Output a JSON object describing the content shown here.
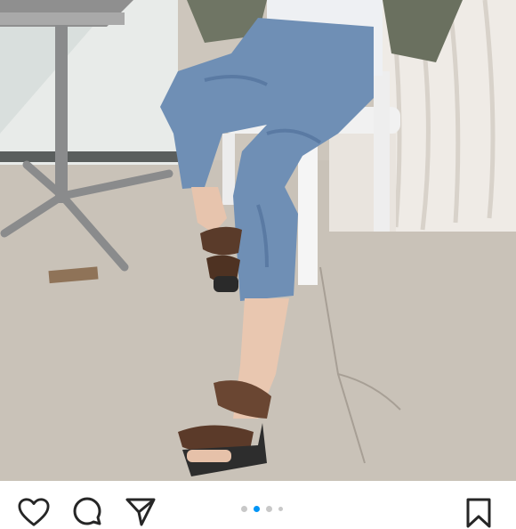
{
  "post": {
    "image_description_icon": "photo",
    "carousel": {
      "count": 5,
      "active_index": 1
    }
  },
  "actions": {
    "like_icon": "heart-icon",
    "comment_icon": "comment-icon",
    "share_icon": "send-icon",
    "save_icon": "bookmark-icon"
  },
  "colors": {
    "active_dot": "#0095f6",
    "inactive_dot": "#c8c8c8",
    "icon": "#262626"
  }
}
